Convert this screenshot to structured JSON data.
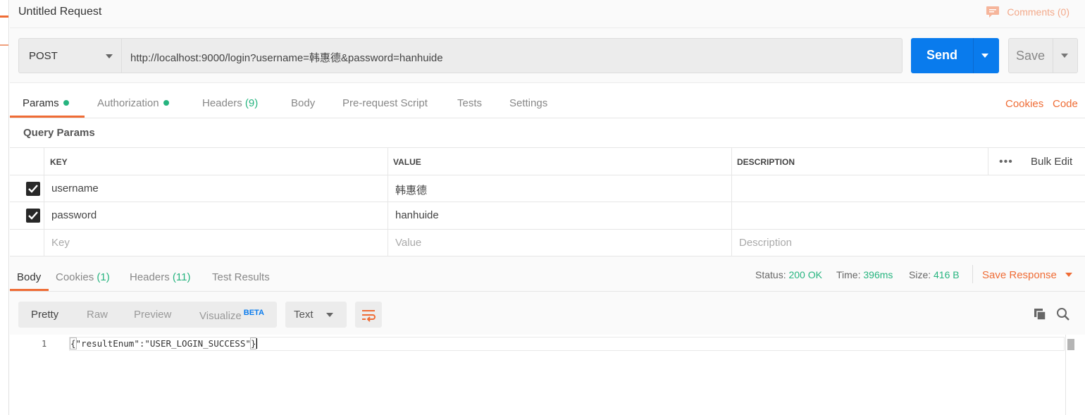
{
  "title": "Untitled Request",
  "comments_label": "Comments (0)",
  "request": {
    "method": "POST",
    "url": "http://localhost:9000/login?username=韩惠德&password=hanhuide",
    "send_label": "Send",
    "save_label": "Save"
  },
  "request_tabs": {
    "params": "Params",
    "authorization": "Authorization",
    "headers": "Headers",
    "headers_count": "(9)",
    "body": "Body",
    "pre_request_script": "Pre-request Script",
    "tests": "Tests",
    "settings": "Settings",
    "cookies_link": "Cookies",
    "code_link": "Code"
  },
  "query_params": {
    "title": "Query Params",
    "headers": {
      "key": "KEY",
      "value": "VALUE",
      "description": "DESCRIPTION"
    },
    "bulk_edit": "Bulk Edit",
    "more_icon": "•••",
    "rows": [
      {
        "checked": true,
        "key": "username",
        "value": "韩惠德",
        "description": ""
      },
      {
        "checked": true,
        "key": "password",
        "value": "hanhuide",
        "description": ""
      }
    ],
    "placeholders": {
      "key": "Key",
      "value": "Value",
      "description": "Description"
    }
  },
  "response": {
    "tabs": {
      "body": "Body",
      "cookies": "Cookies",
      "cookies_count": "(1)",
      "headers": "Headers",
      "headers_count": "(11)",
      "test_results": "Test Results"
    },
    "status_label": "Status:",
    "status_value": "200 OK",
    "time_label": "Time:",
    "time_value": "396ms",
    "size_label": "Size:",
    "size_value": "416 B",
    "save_response": "Save Response",
    "view_modes": {
      "pretty": "Pretty",
      "raw": "Raw",
      "preview": "Preview",
      "visualize": "Visualize",
      "beta": "BETA"
    },
    "format": "Text",
    "line_number": "1",
    "body_text": "\"resultEnum\":\"USER_LOGIN_SUCCESS\"",
    "brace_open": "{",
    "brace_close": "}"
  },
  "colors": {
    "accent_orange": "#ef6c35",
    "send_blue": "#097bed",
    "status_green": "#26b47f"
  }
}
